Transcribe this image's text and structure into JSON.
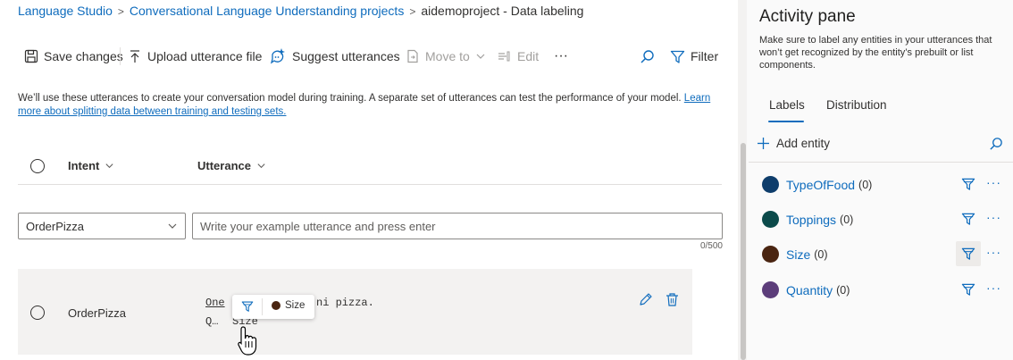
{
  "breadcrumb": {
    "items": [
      "Language Studio",
      "Conversational Language Understanding projects"
    ],
    "current": "aidemoproject - Data labeling"
  },
  "toolbar": {
    "save": "Save changes",
    "upload": "Upload utterance file",
    "suggest": "Suggest utterances",
    "move": "Move to",
    "edit": "Edit",
    "more": "···",
    "filter": "Filter"
  },
  "info": {
    "text": "We’ll use these utterances to create your conversation model during training. A separate set of utterances can test the performance of your model. ",
    "link": "Learn more about splitting data between training and testing sets."
  },
  "table": {
    "headers": {
      "intent": "Intent",
      "utterance": "Utterance"
    },
    "new_row": {
      "intent": "OrderPizza",
      "placeholder": "Write your example utterance and press enter",
      "counter": "0/500"
    },
    "rows": [
      {
        "intent": "OrderPizza",
        "word_labeled": "One",
        "utterance_rest": "ni pizza.",
        "label_line_left": "Q…",
        "label_line_right": "Size"
      }
    ]
  },
  "popup": {
    "label": "Size",
    "color": "#4a2511"
  },
  "pane": {
    "title": "Activity pane",
    "description": "Make sure to label any entities in your utterances that won’t get recognized by the entity’s prebuilt or list components.",
    "tabs": [
      "Labels",
      "Distribution"
    ],
    "active_tab": "Labels",
    "add_entity": "Add entity",
    "entities": [
      {
        "name": "TypeOfFood",
        "count": "(0)",
        "color": "#0e3d6b"
      },
      {
        "name": "Toppings",
        "count": "(0)",
        "color": "#0b4a4a"
      },
      {
        "name": "Size",
        "count": "(0)",
        "color": "#4a2511"
      },
      {
        "name": "Quantity",
        "count": "(0)",
        "color": "#5c3d7a"
      }
    ]
  },
  "colors": {
    "accent": "#0f6cbd"
  }
}
